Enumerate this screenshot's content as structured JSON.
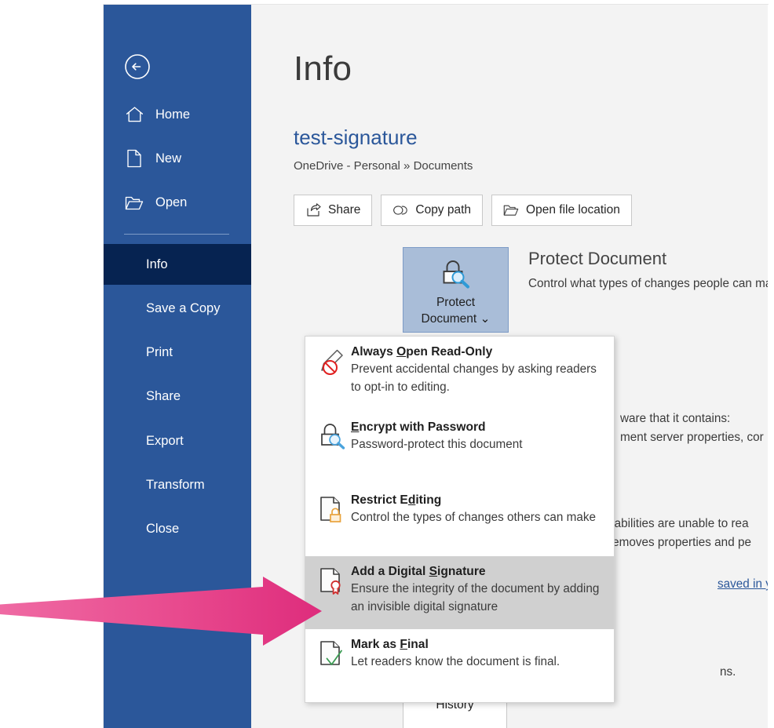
{
  "app": {
    "screen_name": "Word Backstage — Info"
  },
  "nav": {
    "back_label": "Back",
    "back_icon": "circle-arrow-left-icon",
    "top_items": [
      {
        "label": "Home",
        "icon": "home-icon"
      },
      {
        "label": "New",
        "icon": "new-document-icon"
      },
      {
        "label": "Open",
        "icon": "open-folder-icon"
      }
    ],
    "items": [
      {
        "label": "Info",
        "selected": true
      },
      {
        "label": "Save a Copy",
        "selected": false
      },
      {
        "label": "Print",
        "selected": false
      },
      {
        "label": "Share",
        "selected": false
      },
      {
        "label": "Export",
        "selected": false
      },
      {
        "label": "Transform",
        "selected": false
      },
      {
        "label": "Close",
        "selected": false
      }
    ]
  },
  "info": {
    "page_title": "Info",
    "document_name": "test-signature",
    "document_path": "OneDrive - Personal » Documents",
    "actions": [
      {
        "label": "Share",
        "icon": "share-icon"
      },
      {
        "label": "Copy path",
        "icon": "link-icon"
      },
      {
        "label": "Open file location",
        "icon": "folder-open-icon"
      }
    ],
    "protect": {
      "tile_label_line1": "Protect",
      "tile_label_line2": "Document",
      "tile_chevron": "chevron-down-icon",
      "tile_icon": "lock-magnifier-icon",
      "heading": "Protect Document",
      "description": "Control what types of changes people can make to this document."
    },
    "inspect": {
      "description_line1": "ware that it contains:",
      "description_line2": "ment server properties, cor"
    },
    "accessibility": {
      "description_line1": "sabilities are unable to rea",
      "description_line2": "removes properties and pe"
    },
    "versions": {
      "link_text": "saved in your file",
      "history_button": "History"
    },
    "trailing_text": "ns."
  },
  "menu": {
    "name": "protect-document-menu",
    "items": [
      {
        "title_pre": "Always ",
        "title_accel": "O",
        "title_post": "pen Read-Only",
        "title_plain": "Always Open Read-Only",
        "desc": "Prevent accidental changes by asking readers to opt-in to editing.",
        "icon": "pencil-no-entry-icon",
        "highlighted": false
      },
      {
        "title_pre": "",
        "title_accel": "E",
        "title_post": "ncrypt with Password",
        "title_plain": "Encrypt with Password",
        "desc": "Password-protect this document",
        "icon": "lock-magnifier-icon",
        "highlighted": false
      },
      {
        "title_pre": "Restrict E",
        "title_accel": "d",
        "title_post": "iting",
        "title_plain": "Restrict Editing",
        "desc": "Control the types of changes others can make",
        "icon": "document-lock-icon",
        "highlighted": false
      },
      {
        "title_pre": "Add a Digital ",
        "title_accel": "S",
        "title_post": "ignature",
        "title_plain": "Add a Digital Signature",
        "desc": "Ensure the integrity of the document by adding an invisible digital signature",
        "icon": "document-seal-icon",
        "highlighted": true
      },
      {
        "title_pre": "Mark as ",
        "title_accel": "F",
        "title_post": "inal",
        "title_plain": "Mark as Final",
        "desc": "Let readers know the document is final.",
        "icon": "document-check-icon",
        "highlighted": false
      }
    ]
  },
  "annotation": {
    "name": "pink-arrow-pointer",
    "shape": "arrow-right",
    "color": "#e0357f",
    "points_to": "Add a Digital Signature"
  },
  "colors": {
    "nav_blue": "#2b579a",
    "nav_selected": "#062351",
    "backstage_bg": "#f3f3f3",
    "tile_bg": "#a9bdd8",
    "menu_highlight": "#d0d0d0",
    "link_blue": "#2b579a",
    "arrow_pink": "#e0357f"
  }
}
